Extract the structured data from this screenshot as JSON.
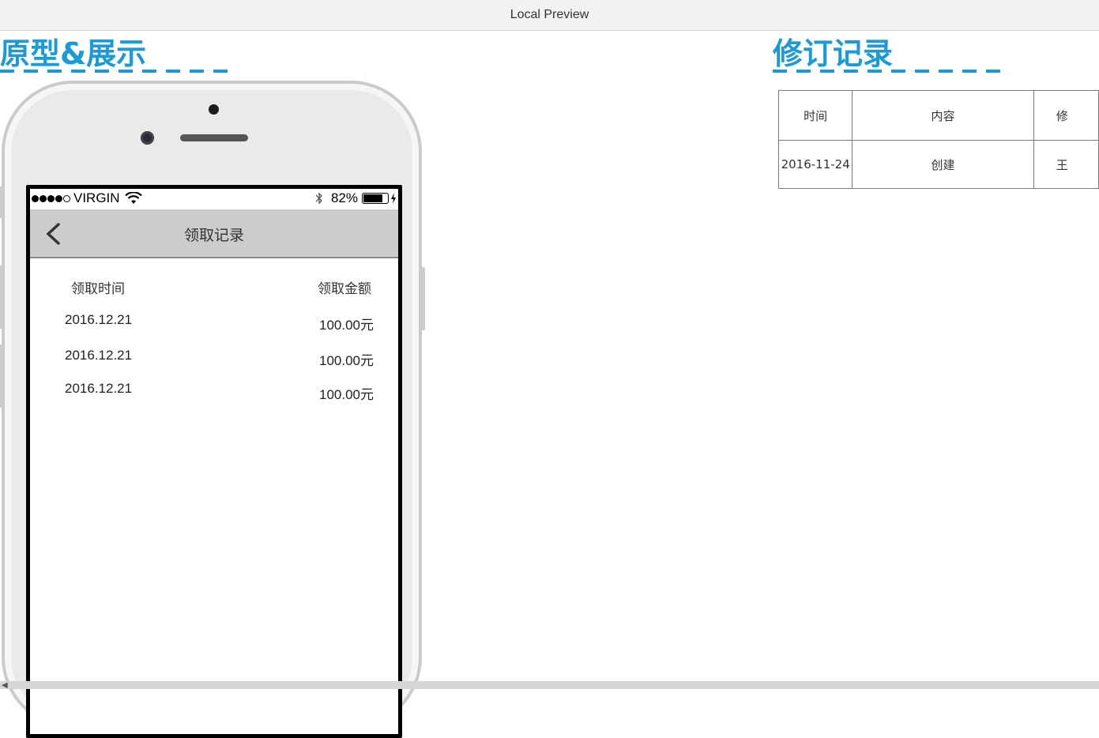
{
  "window": {
    "title": "Local Preview"
  },
  "prototype": {
    "heading": "原型&展示"
  },
  "revision": {
    "heading": "修订记录",
    "columns": [
      "时间",
      "内容",
      "修"
    ],
    "rows": [
      [
        "2016-11-24",
        "创建",
        "王"
      ]
    ]
  },
  "phone": {
    "status": {
      "carrier": "VIRGIN",
      "battery": "82%",
      "signal_dots": 5
    },
    "nav_title": "领取记录",
    "list": {
      "header_time": "领取时间",
      "header_amount": "领取金额",
      "rows": [
        {
          "date": "2016.12.21",
          "amount": "100.00元"
        },
        {
          "date": "2016.12.21",
          "amount": "100.00元"
        },
        {
          "date": "2016.12.21",
          "amount": "100.00元"
        }
      ]
    }
  },
  "colors": {
    "accent": "#1a9ad6",
    "navbar": "#cccccc"
  }
}
